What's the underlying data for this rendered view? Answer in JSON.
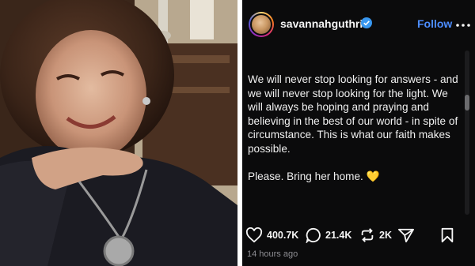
{
  "post": {
    "username": "savannahguthrie",
    "verified_icon": "verified-badge-icon",
    "follow_label": "Follow",
    "caption_p1": "We will never stop looking for answers - and we will never stop looking for the light. We will always be hoping and praying and believing in the best of our world - in spite of circumstance. This is what our faith makes possible.",
    "caption_p2": "Please. Bring her home.",
    "caption_emoji": "💛",
    "likes": "400.7K",
    "comments": "21.4K",
    "reposts": "2K",
    "timestamp": "14 hours ago"
  },
  "colors": {
    "panel_bg": "#0b0b0c",
    "follow_blue": "#4c8dff",
    "verified_blue": "#3897f0",
    "muted_text": "#8e8e93",
    "emoji_yellow": "#f6c243"
  },
  "icons": [
    "verified-badge-icon",
    "more-options-icon",
    "heart-icon",
    "comment-icon",
    "repost-icon",
    "share-icon",
    "bookmark-icon"
  ]
}
